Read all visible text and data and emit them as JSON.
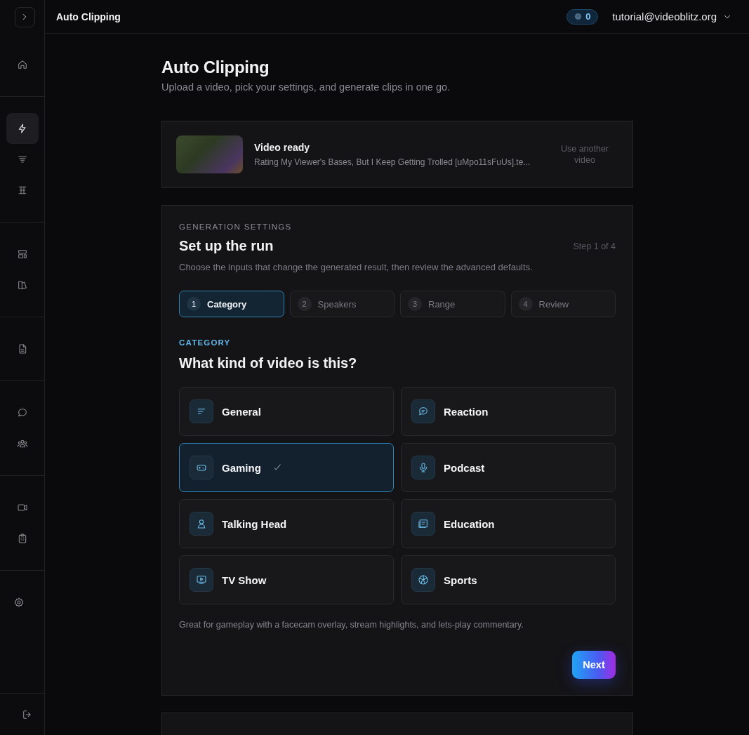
{
  "header": {
    "title": "Auto Clipping",
    "credits": "0",
    "account": "tutorial@videoblitz.org"
  },
  "sidebar": {
    "groups": [
      {
        "items": [
          {
            "selected": false
          }
        ]
      },
      {
        "items": [
          {
            "selected": true
          },
          {
            "selected": false
          },
          {
            "selected": false
          }
        ]
      },
      {
        "items": [
          {
            "selected": false
          },
          {
            "selected": false
          }
        ]
      },
      {
        "items": [
          {
            "selected": false
          }
        ]
      },
      {
        "items": [
          {
            "selected": false
          },
          {
            "selected": false
          }
        ]
      },
      {
        "items": [
          {
            "selected": false
          },
          {
            "selected": false
          }
        ]
      },
      {
        "items": [
          {
            "selected": false
          }
        ]
      }
    ]
  },
  "page": {
    "title": "Auto Clipping",
    "subtitle": "Upload a video, pick your settings, and generate clips in one go."
  },
  "upload": {
    "status": "Video ready",
    "filename": "Rating My Viewer's Bases, But I Keep Getting Trolled [uMpo11sFuUs].te...",
    "action": "Use another video"
  },
  "settings": {
    "eyebrow": "GENERATION SETTINGS",
    "title": "Set up the run",
    "step": "Step 1 of 4",
    "description": "Choose the inputs that change the generated result, then review the advanced defaults.",
    "steps": [
      {
        "number": "1",
        "label": "Category",
        "selected": true
      },
      {
        "number": "2",
        "label": "Speakers",
        "selected": false
      },
      {
        "number": "3",
        "label": "Range",
        "selected": false
      },
      {
        "number": "4",
        "label": "Review",
        "selected": false
      }
    ],
    "section_label": "CATEGORY",
    "question": "What kind of video is this?",
    "categories": [
      {
        "label": "General",
        "selected": false
      },
      {
        "label": "Reaction",
        "selected": false
      },
      {
        "label": "Gaming",
        "selected": true
      },
      {
        "label": "Podcast",
        "selected": false
      },
      {
        "label": "Talking Head",
        "selected": false
      },
      {
        "label": "Education",
        "selected": false
      },
      {
        "label": "TV Show",
        "selected": false
      },
      {
        "label": "Sports",
        "selected": false
      }
    ],
    "hint": "Great for gameplay with a facecam overlay, stream highlights, and lets-play commentary.",
    "next": "Next"
  }
}
